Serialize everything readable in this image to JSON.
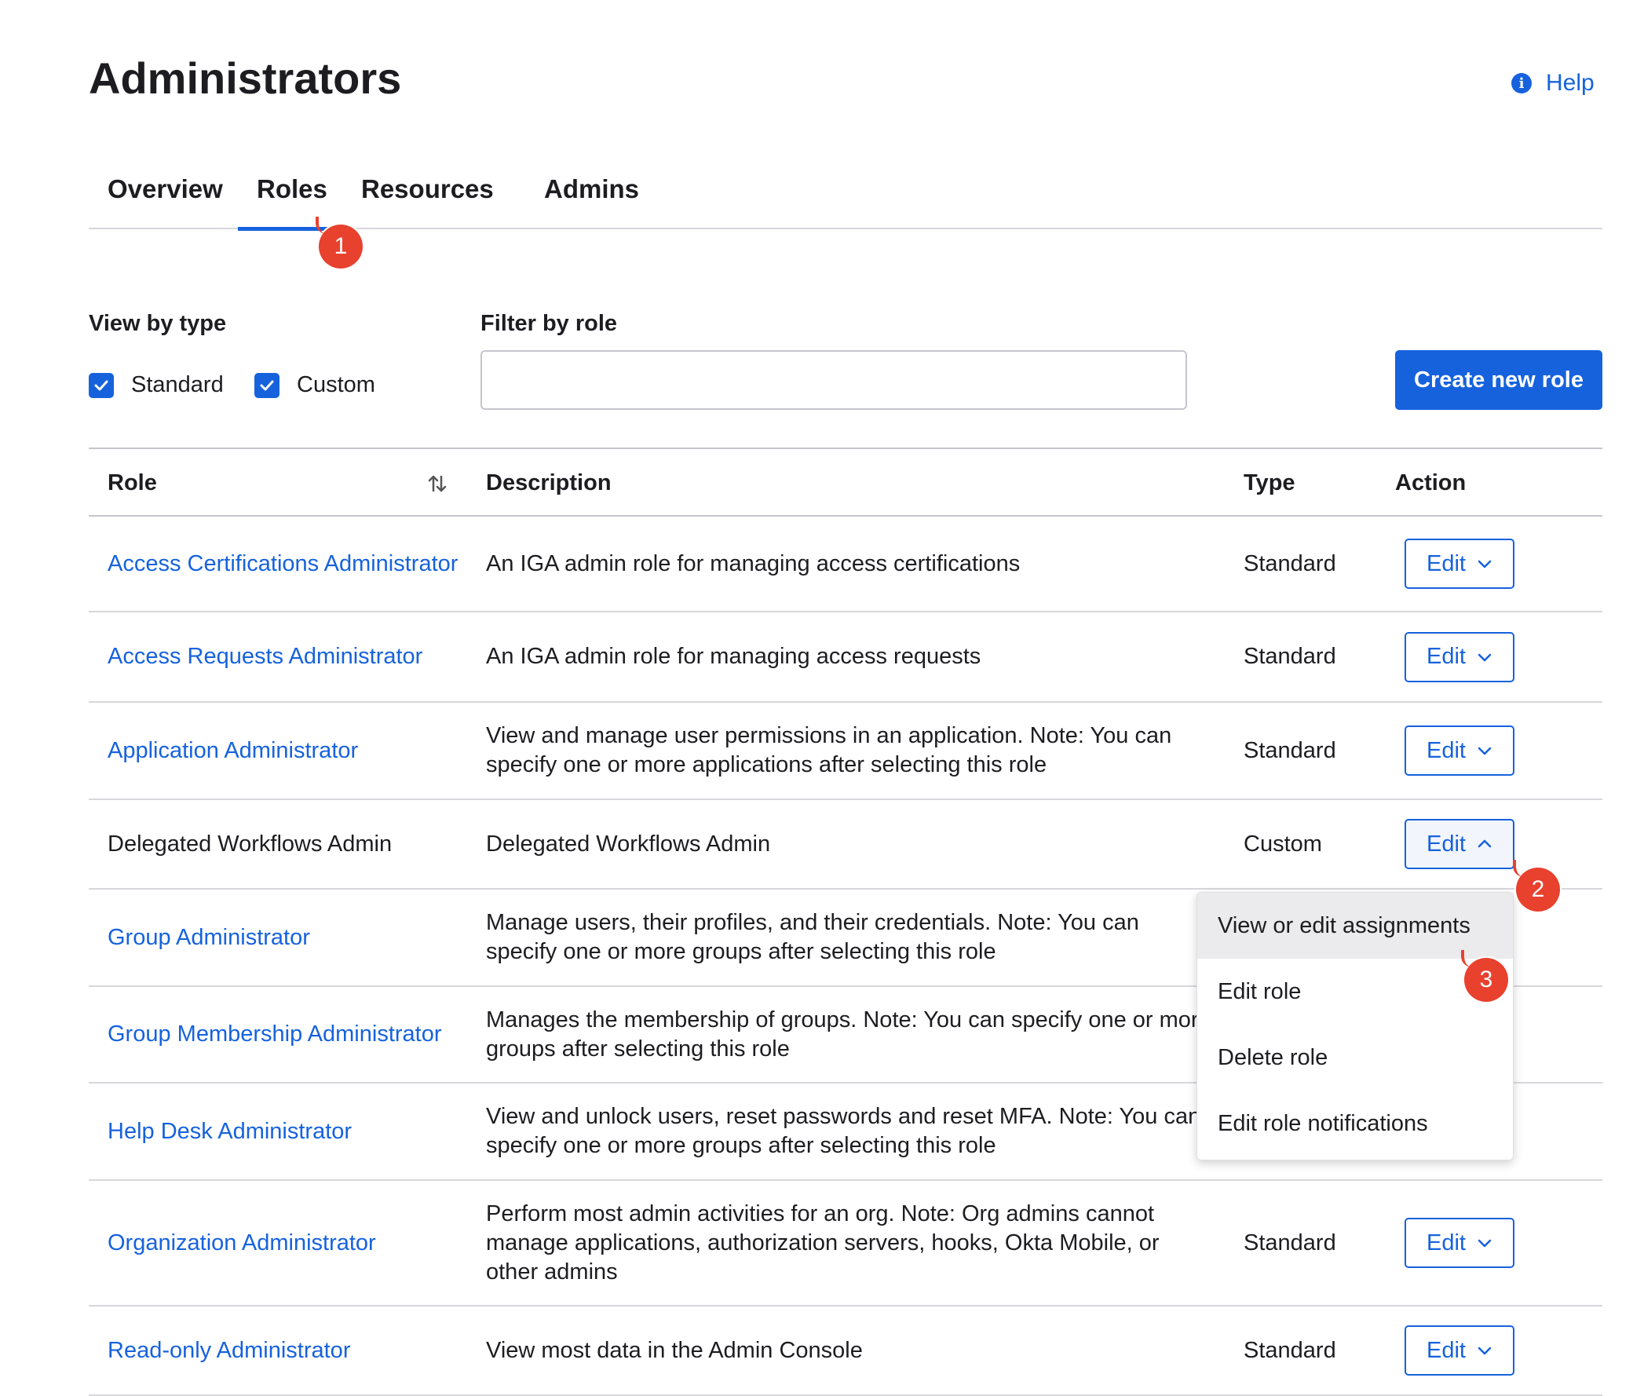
{
  "header": {
    "title": "Administrators",
    "help_label": "Help",
    "help_icon": "info-circle-icon"
  },
  "tabs": [
    {
      "label": "Overview",
      "active": false
    },
    {
      "label": "Roles",
      "active": true
    },
    {
      "label": "Resources",
      "active": false
    },
    {
      "label": "Admins",
      "active": false
    }
  ],
  "filters": {
    "view_by_type_label": "View by type",
    "standard_label": "Standard",
    "standard_checked": true,
    "custom_label": "Custom",
    "custom_checked": true,
    "filter_by_role_label": "Filter by role",
    "filter_value": "",
    "create_button_label": "Create new role"
  },
  "table": {
    "headers": {
      "role": "Role",
      "description": "Description",
      "type": "Type",
      "action": "Action"
    },
    "edit_label": "Edit",
    "rows": [
      {
        "role": "Access Certifications Administrator",
        "description": "An IGA admin role for managing access certifications",
        "type": "Standard",
        "link": true
      },
      {
        "role": "Access Requests Administrator",
        "description": "An IGA admin role for managing access requests",
        "type": "Standard",
        "link": true
      },
      {
        "role": "Application Administrator",
        "description": "View and manage user permissions in an application. Note: You can specify one or more applications after selecting this role",
        "type": "Standard",
        "link": true
      },
      {
        "role": "Delegated Workflows Admin",
        "description": "Delegated Workflows Admin",
        "type": "Custom",
        "link": false
      },
      {
        "role": "Group Administrator",
        "description": "Manage users, their profiles, and their credentials. Note: You can specify one or more groups after selecting this role",
        "type": "",
        "link": true
      },
      {
        "role": "Group Membership Administrator",
        "description": "Manages the membership of groups. Note: You can specify one or more groups after selecting this role",
        "type": "",
        "link": true
      },
      {
        "role": "Help Desk Administrator",
        "description": "View and unlock users, reset passwords and reset MFA. Note: You can specify one or more groups after selecting this role",
        "type": "",
        "link": true
      },
      {
        "role": "Organization Administrator",
        "description": "Perform most admin activities for an org. Note: Org admins cannot manage applications, authorization servers, hooks, Okta Mobile, or other admins",
        "type": "Standard",
        "link": true
      },
      {
        "role": "Read-only Administrator",
        "description": "View most data in the Admin Console",
        "type": "Standard",
        "link": true
      }
    ]
  },
  "dropdown": {
    "items": [
      "View or edit assignments",
      "Edit role",
      "Delete role",
      "Edit role notifications"
    ],
    "highlighted": "View or edit assignments"
  },
  "annotations": [
    "1",
    "2",
    "3"
  ],
  "colors": {
    "accent": "#1662dd",
    "annotation": "#e8412e",
    "text": "#1d1d21"
  }
}
